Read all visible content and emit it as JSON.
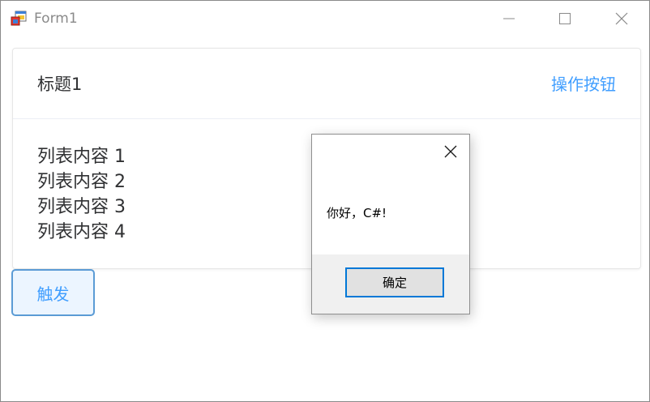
{
  "window": {
    "title": "Form1",
    "icon": "winforms-app-icon",
    "controls": [
      "minimize-icon",
      "maximize-icon",
      "close-icon"
    ]
  },
  "card": {
    "title": "标题1",
    "action_label": "操作按钮",
    "items": [
      "列表内容 1",
      "列表内容 2",
      "列表内容 3",
      "列表内容 4"
    ]
  },
  "trigger_button": {
    "label": "触发"
  },
  "message_box": {
    "message": "你好，C#!",
    "ok_label": "确定"
  },
  "colors": {
    "accent": "#409eff",
    "text": "#303133",
    "border": "#ebeef5",
    "dialog_button_border": "#0078d7"
  }
}
